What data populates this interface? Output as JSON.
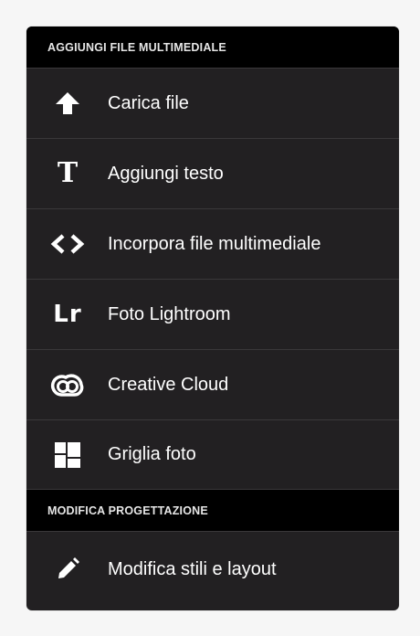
{
  "sections": [
    {
      "header": "AGGIUNGI FILE MULTIMEDIALE",
      "items": [
        {
          "label": "Carica file",
          "icon": "upload-arrow-icon"
        },
        {
          "label": "Aggiungi testo",
          "icon": "text-t-icon"
        },
        {
          "label": "Incorpora file multimediale",
          "icon": "embed-code-icon"
        },
        {
          "label": "Foto Lightroom",
          "icon": "lightroom-icon",
          "icon_text": "Lr"
        },
        {
          "label": "Creative Cloud",
          "icon": "creative-cloud-icon"
        },
        {
          "label": "Griglia foto",
          "icon": "photo-grid-icon"
        }
      ]
    },
    {
      "header": "MODIFICA PROGETTAZIONE",
      "items": [
        {
          "label": "Modifica stili e layout",
          "icon": "pencil-icon"
        }
      ]
    }
  ],
  "colors": {
    "panel_bg": "#222022",
    "header_bg": "#000000",
    "page_bg": "#f6f6f6",
    "text": "#ffffff"
  }
}
